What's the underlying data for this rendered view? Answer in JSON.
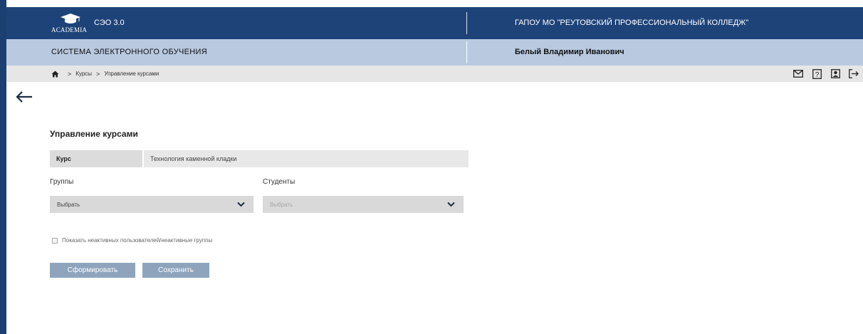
{
  "header": {
    "logo_text": "ACADEMIA",
    "app_version": "СЭО 3.0",
    "org_name": "ГАПОУ МО \"РЕУТОВСКИЙ ПРОФЕССИОНАЛЬНЫЙ КОЛЛЕДЖ\"",
    "system_title": "СИСТЕМА ЭЛЕКТРОННОГО ОБУЧЕНИЯ",
    "user_name": "Белый Владимир Иванович"
  },
  "breadcrumb": {
    "home_icon": "home-icon",
    "items": [
      "Курсы",
      "Управление курсами"
    ],
    "separator": ">"
  },
  "header_icons": [
    "mail-icon",
    "help-icon",
    "profile-icon",
    "logout-icon"
  ],
  "page": {
    "title": "Управление курсами",
    "course_label": "Курс",
    "course_value": "Технология каменной кладки",
    "groups_label": "Группы",
    "students_label": "Студенты",
    "groups_select_value": "Выбрать",
    "students_select_value": "Выбрать",
    "checkbox_label": "Показать неактивных пользователей/неактивные группы",
    "form_button": "Сформировать",
    "save_button": "Сохранить"
  },
  "colors": {
    "topbar": "#1e4379",
    "subbar": "#b8c9e0",
    "crumbbar": "#e6e6e6",
    "button": "#8ea4bd"
  }
}
